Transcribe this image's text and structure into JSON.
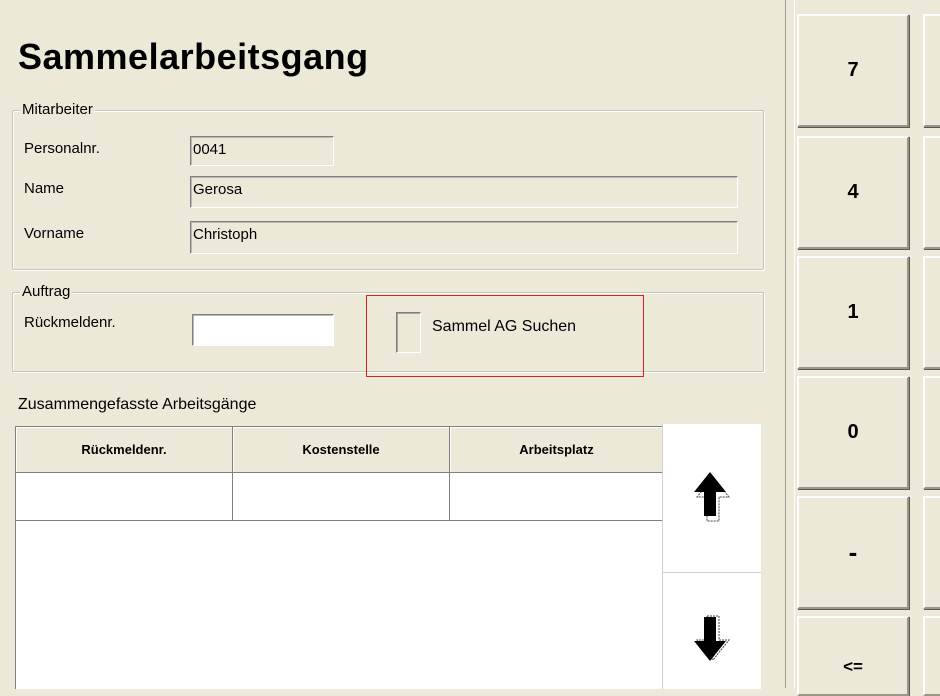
{
  "title": "Sammelarbeitsgang",
  "mitarbeiter": {
    "legend": "Mitarbeiter",
    "personalnr_label": "Personalnr.",
    "personalnr_value": "0041",
    "name_label": "Name",
    "name_value": "Gerosa",
    "vorname_label": "Vorname",
    "vorname_value": "Christoph"
  },
  "auftrag": {
    "legend": "Auftrag",
    "rueckmeldenr_label": "Rückmeldenr.",
    "rueckmeldenr_value": "",
    "sammel_checkbox_label": "Sammel AG Suchen"
  },
  "table": {
    "caption": "Zusammengefasste Arbeitsgänge",
    "columns": [
      "Rückmeldenr.",
      "Kostenstelle",
      "Arbeitsplatz"
    ],
    "rows": [
      [
        "",
        "",
        ""
      ]
    ]
  },
  "keypad": {
    "keys": [
      "7",
      "4",
      "1",
      "0",
      "-",
      "<="
    ]
  },
  "icons": {
    "scroll_up": "arrow-up-icon",
    "scroll_down": "arrow-down-icon"
  }
}
